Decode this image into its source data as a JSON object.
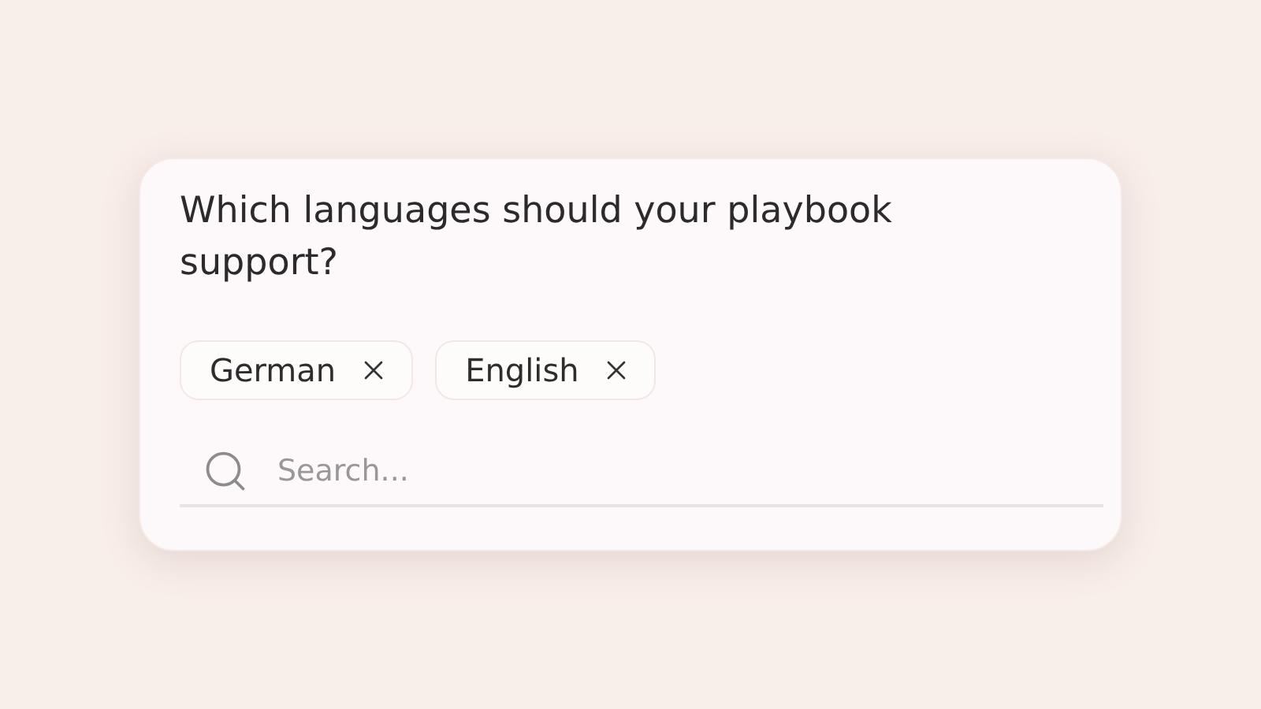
{
  "question": "Which languages should your playbook support?",
  "chips": [
    {
      "label": "German"
    },
    {
      "label": "English"
    }
  ],
  "search": {
    "placeholder": "Search..."
  }
}
